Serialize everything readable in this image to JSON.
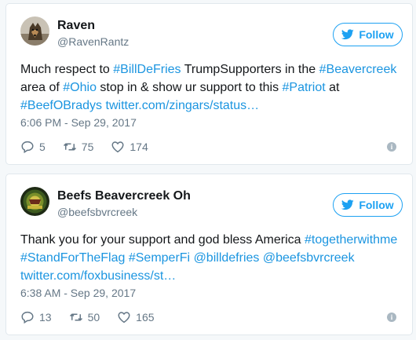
{
  "tweets": [
    {
      "name": "Raven",
      "handle": "@RavenRantz",
      "follow_label": "Follow",
      "text": [
        {
          "t": "Much respect to ",
          "link": false
        },
        {
          "t": "#BillDeFries",
          "link": true
        },
        {
          "t": " TrumpSupporters in the ",
          "link": false
        },
        {
          "t": "#Beavercreek",
          "link": true
        },
        {
          "t": " area of ",
          "link": false
        },
        {
          "t": "#Ohio",
          "link": true
        },
        {
          "t": " stop in & show ur support to this ",
          "link": false
        },
        {
          "t": "#Patriot",
          "link": true
        },
        {
          "t": " at ",
          "link": false
        },
        {
          "t": "#BeefOBradys",
          "link": true
        },
        {
          "t": " ",
          "link": false
        },
        {
          "t": "twitter.com/zingars/status…",
          "link": true
        }
      ],
      "timestamp": "6:06 PM - Sep 29, 2017",
      "replies": "5",
      "retweets": "75",
      "likes": "174"
    },
    {
      "name": "Beefs Beavercreek Oh",
      "handle": "@beefsbvrcreek",
      "follow_label": "Follow",
      "text": [
        {
          "t": "Thank you for your support and god bless America ",
          "link": false
        },
        {
          "t": "#togetherwithme",
          "link": true
        },
        {
          "t": " ",
          "link": false
        },
        {
          "t": "#StandForTheFlag",
          "link": true
        },
        {
          "t": " ",
          "link": false
        },
        {
          "t": "#SemperFi",
          "link": true
        },
        {
          "t": " ",
          "link": false
        },
        {
          "t": "@billdefries",
          "link": true
        },
        {
          "t": " ",
          "link": false
        },
        {
          "t": "@beefsbvrcreek",
          "link": true
        },
        {
          "t": " ",
          "link": false
        },
        {
          "t": "twitter.com/foxbusiness/st…",
          "link": true
        }
      ],
      "timestamp": "6:38 AM - Sep 29, 2017",
      "replies": "13",
      "retweets": "50",
      "likes": "165"
    }
  ],
  "colors": {
    "link": "#1b95e0",
    "brand": "#1da1f2",
    "muted": "#657786"
  },
  "icons": [
    "twitter-bird-icon",
    "reply-icon",
    "retweet-icon",
    "like-icon",
    "info-icon"
  ]
}
